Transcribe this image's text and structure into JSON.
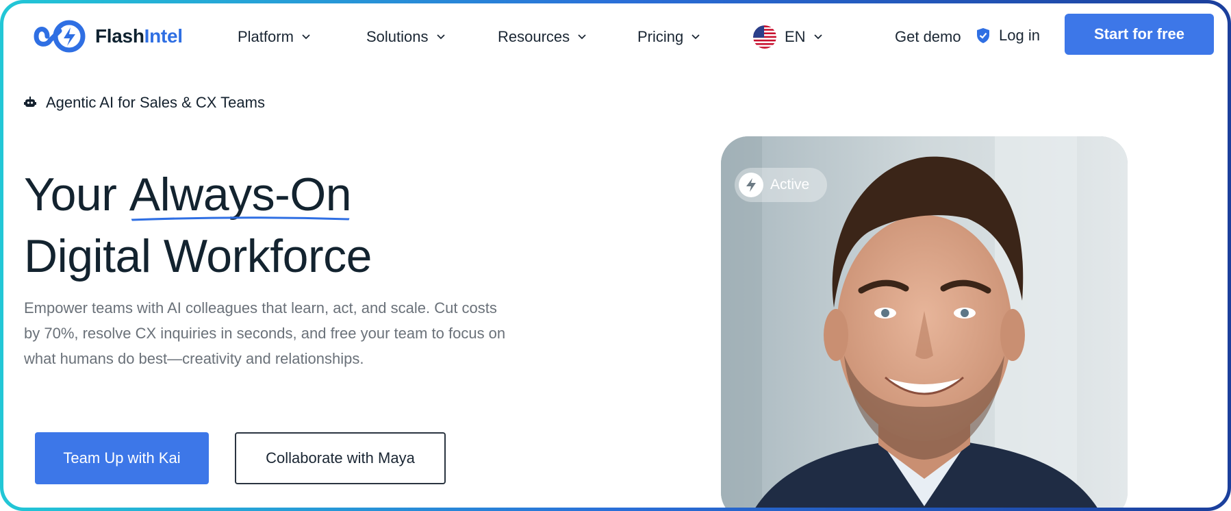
{
  "brand": {
    "name_part1": "Flash",
    "name_part2": "Intel",
    "accent": "#2f6fe3"
  },
  "nav": {
    "items": [
      {
        "label": "Platform"
      },
      {
        "label": "Solutions"
      },
      {
        "label": "Resources"
      },
      {
        "label": "Pricing"
      }
    ],
    "language": "EN",
    "get_demo": "Get demo",
    "login": "Log in",
    "start_free": "Start for free"
  },
  "hero": {
    "badge": "Agentic AI for Sales & CX Teams",
    "title_prefix": "Your ",
    "title_highlight": "Always-On",
    "title_line2": "Digital Workforce",
    "description": "Empower teams with AI colleagues that learn, act, and scale. Cut costs by 70%, resolve CX inquiries in seconds, and free your team to focus on what humans do best—creativity and relationships.",
    "primary_cta": "Team Up with Kai",
    "secondary_cta": "Collaborate with Maya",
    "photo_status": "Active"
  },
  "icons": [
    "logo-icon",
    "chevron-down-icon",
    "us-flag-icon",
    "shield-icon",
    "robot-icon",
    "bolt-icon"
  ],
  "colors": {
    "primary": "#3d77e8",
    "text": "#13232f",
    "muted": "#6a7179",
    "frame_start": "#22c7d6",
    "frame_end": "#1b3f9c"
  }
}
